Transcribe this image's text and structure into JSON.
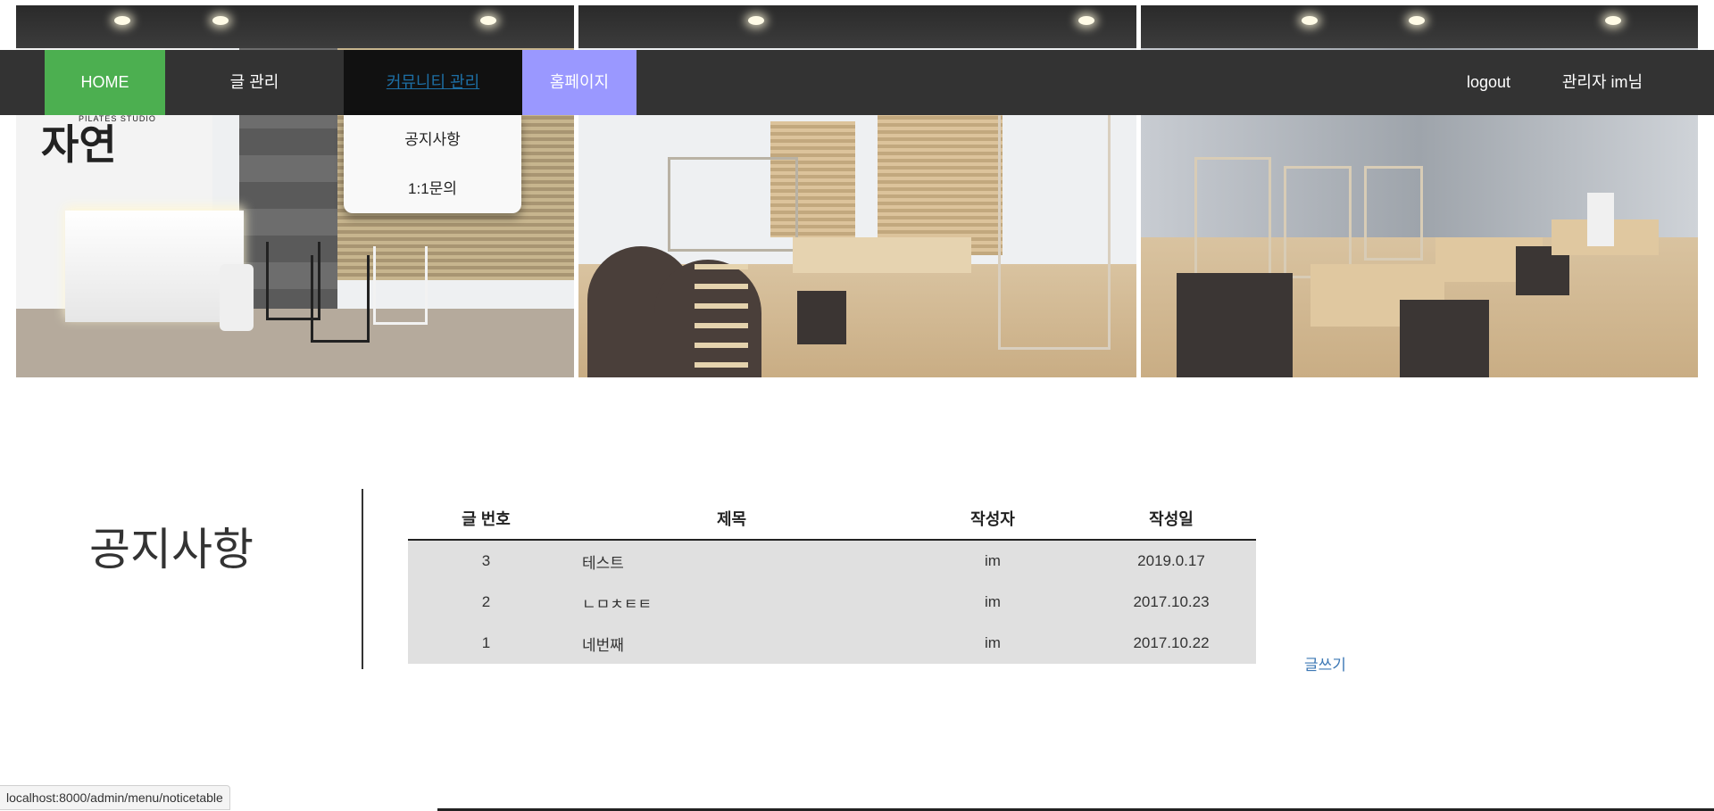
{
  "nav": {
    "home": "HOME",
    "posts": "글 관리",
    "community": "커뮤니티 관리",
    "homepage": "홈페이지",
    "logout": "logout",
    "admin": "관리자 im님"
  },
  "dropdown": {
    "items": [
      "공지사항",
      "1:1문의"
    ]
  },
  "board": {
    "title": "공지사항",
    "columns": [
      "글 번호",
      "제목",
      "작성자",
      "작성일"
    ],
    "rows": [
      {
        "no": "3",
        "title": "테스트",
        "author": "im",
        "date": "2019.0.17"
      },
      {
        "no": "2",
        "title": "ㄴㅁㅊㅌㅌ",
        "author": "im",
        "date": "2017.10.23"
      },
      {
        "no": "1",
        "title": "네번째",
        "author": "im",
        "date": "2017.10.22"
      }
    ],
    "write": "글쓰기"
  },
  "photos": {
    "logo_text": "자연",
    "logo_sub": "PILATES STUDIO"
  },
  "status_url": "localhost:8000/admin/menu/noticetable",
  "colors": {
    "navbar": "#333333",
    "home_active": "#4caf50",
    "homepage_tab": "#9a98ff",
    "link": "#3d78b5"
  }
}
